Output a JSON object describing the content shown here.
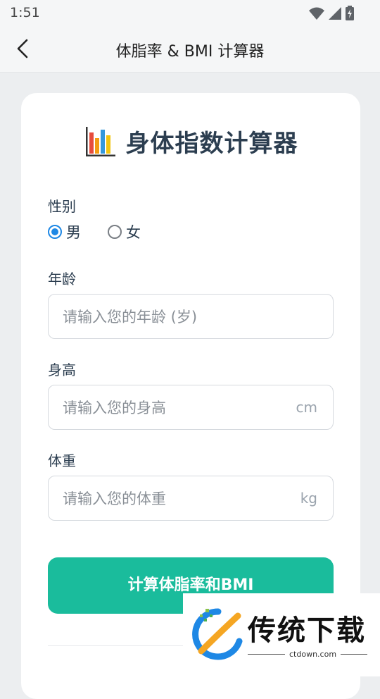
{
  "status_bar": {
    "time": "1:51"
  },
  "app_bar": {
    "title": "体脂率 & BMI 计算器",
    "back_icon": "chevron-left-icon"
  },
  "card": {
    "heading": "身体指数计算器",
    "heading_icon": "bar-chart-icon",
    "gender": {
      "label": "性别",
      "options": [
        {
          "label": "男",
          "selected": true
        },
        {
          "label": "女",
          "selected": false
        }
      ]
    },
    "age": {
      "label": "年龄",
      "placeholder": "请输入您的年龄 (岁)",
      "value": ""
    },
    "height": {
      "label": "身高",
      "placeholder": "请输入您的身高",
      "unit": "cm",
      "value": ""
    },
    "weight": {
      "label": "体重",
      "placeholder": "请输入您的体重",
      "unit": "kg",
      "value": ""
    },
    "calculate_button": "计算体脂率和BMI"
  },
  "watermark": {
    "text": "传统下载",
    "url": "ctdown.com"
  },
  "colors": {
    "accent": "#1abc9c",
    "radio": "#1e88e5",
    "heading": "#2c3e50",
    "background": "#eceef0"
  }
}
